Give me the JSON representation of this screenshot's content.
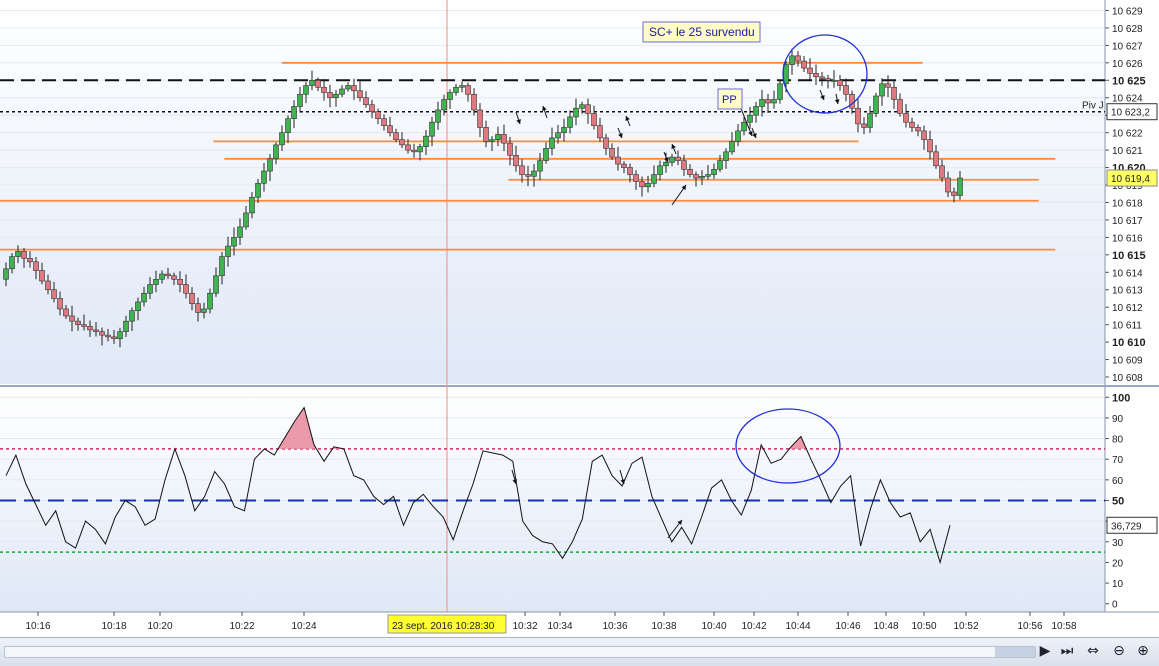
{
  "chart_data": [
    {
      "type": "candlestick",
      "title": "",
      "ylim": [
        10607.6,
        10629.6
      ],
      "y_ticks": [
        10608,
        10609,
        10610,
        10611,
        10612,
        10613,
        10614,
        10615,
        10616,
        10617,
        10618,
        10619,
        10620,
        10621,
        10622,
        10623,
        10624,
        10625,
        10626,
        10627,
        10628,
        10629
      ],
      "y_tick_labels": [
        "10 608",
        "10 609",
        "10 610",
        "10 611",
        "10 612",
        "10 613",
        "10 614",
        "10 615",
        "10 616",
        "10 617",
        "10 618",
        "10 619",
        "10 620",
        "10 621",
        "10 622",
        "10 623",
        "10 624",
        "10 625",
        "10 626",
        "10 627",
        "10 628",
        "10 629"
      ],
      "bold_ticks": [
        10610,
        10615,
        10620,
        10625
      ],
      "close_series": [
        10614.2,
        10614.9,
        10615.2,
        10614.8,
        10614.6,
        10614.1,
        10613.5,
        10613.0,
        10612.5,
        10611.9,
        10611.5,
        10611.2,
        10611.0,
        10610.9,
        10610.7,
        10610.6,
        10610.4,
        10610.3,
        10610.2,
        10610.6,
        10611.2,
        10611.8,
        10612.3,
        10612.8,
        10613.3,
        10613.6,
        10613.9,
        10613.8,
        10613.6,
        10613.3,
        10612.8,
        10612.2,
        10611.7,
        10611.9,
        10612.8,
        10613.8,
        10614.9,
        10615.5,
        10616.0,
        10616.6,
        10617.4,
        10618.3,
        10619.1,
        10619.8,
        10620.5,
        10621.3,
        10622.0,
        10622.8,
        10623.5,
        10624.2,
        10624.7,
        10625.0,
        10624.6,
        10624.3,
        10624.0,
        10624.2,
        10624.5,
        10624.7,
        10624.4,
        10624.0,
        10623.6,
        10623.2,
        10622.8,
        10622.4,
        10622.0,
        10621.6,
        10621.3,
        10621.0,
        10620.9,
        10621.2,
        10621.8,
        10622.6,
        10623.3,
        10623.9,
        10624.3,
        10624.6,
        10624.7,
        10624.2,
        10623.3,
        10622.3,
        10621.5,
        10621.6,
        10621.9,
        10621.4,
        10620.7,
        10620.1,
        10619.6,
        10619.5,
        10619.8,
        10620.4,
        10621.1,
        10621.7,
        10622.0,
        10622.3,
        10622.9,
        10623.4,
        10623.6,
        10623.1,
        10622.4,
        10621.7,
        10621.1,
        10620.6,
        10620.2,
        10620.0,
        10619.6,
        10619.2,
        10618.9,
        10619.1,
        10619.6,
        10620.1,
        10620.3,
        10620.6,
        10620.4,
        10619.9,
        10619.6,
        10619.4,
        10619.5,
        10619.6,
        10619.9,
        10620.4,
        10620.9,
        10621.5,
        10622.1,
        10622.6,
        10623.0,
        10623.5,
        10623.9,
        10623.7,
        10623.9,
        10624.8,
        10625.9,
        10626.4,
        10626.1,
        10625.7,
        10625.4,
        10625.2,
        10625.1,
        10625.0,
        10625.0,
        10624.7,
        10624.2,
        10623.4,
        10622.5,
        10622.3,
        10623.1,
        10624.1,
        10624.8,
        10624.6,
        10623.9,
        10623.1,
        10622.6,
        10622.3,
        10622.1,
        10621.6,
        10620.9,
        10620.1,
        10619.4,
        10618.6,
        10618.4,
        10619.4
      ],
      "last_price_label": "10 619,4",
      "pivot_label": "Piv J",
      "pivot_value_label": "10 623,2",
      "pivot_level": 10623.2,
      "dashed_level": 10625.0,
      "support_resistance_levels": [
        {
          "y": 10626.0,
          "from": 0.255,
          "to": 0.835
        },
        {
          "y": 10621.5,
          "from": 0.193,
          "to": 0.777
        },
        {
          "y": 10620.5,
          "from": 0.203,
          "to": 0.955
        },
        {
          "y": 10619.3,
          "from": 0.46,
          "to": 0.94
        },
        {
          "y": 10618.1,
          "from": 0.0,
          "to": 0.94
        },
        {
          "y": 10615.3,
          "from": 0.0,
          "to": 0.955
        }
      ],
      "annotations": [
        {
          "text": "SC+ le 25 survendu"
        },
        {
          "text": "PP"
        }
      ]
    },
    {
      "type": "line",
      "ylim": [
        -4,
        104
      ],
      "y_ticks": [
        0,
        10,
        20,
        30,
        40,
        50,
        60,
        70,
        80,
        90,
        100
      ],
      "y_tick_labels": [
        "0",
        "10",
        "20",
        "30",
        "40",
        "50",
        "60",
        "70",
        "80",
        "90",
        "100"
      ],
      "bold_ticks": [
        50,
        100
      ],
      "series": [
        {
          "values": [
            62,
            72,
            58,
            48,
            38,
            45,
            30,
            27,
            40,
            36,
            29,
            42,
            50,
            47,
            38,
            41,
            60,
            75,
            62,
            45,
            52,
            64,
            58,
            47,
            45,
            70,
            75,
            72,
            80,
            88,
            95,
            77,
            69,
            76,
            75,
            62,
            60,
            52,
            48,
            52,
            38,
            49,
            53,
            47,
            42,
            31,
            45,
            58,
            74,
            73,
            72,
            69,
            40,
            33,
            30,
            29,
            22,
            30,
            41,
            69,
            72,
            62,
            57,
            68,
            71,
            52,
            41,
            30,
            37,
            29,
            42,
            56,
            60,
            50,
            43,
            55,
            77,
            68,
            70,
            76,
            81,
            70,
            60,
            49,
            57,
            62,
            28,
            46,
            60,
            49,
            42,
            44,
            30,
            36,
            20,
            38
          ]
        }
      ],
      "current_value_label": "36,729",
      "levels": [
        {
          "y": 75,
          "color": "#e0245e"
        },
        {
          "y": 50,
          "color": "#1a33aa"
        },
        {
          "y": 25,
          "color": "#1aa833"
        }
      ],
      "overbought_fill_color": "#e88a9a"
    }
  ],
  "x_axis": {
    "time_labels": [
      "10:16",
      "10:18",
      "10:20",
      "10:22",
      "10:24",
      "10:32",
      "10:34",
      "10:36",
      "10:38",
      "10:40",
      "10:42",
      "10:44",
      "10:46",
      "10:48",
      "10:50",
      "10:52",
      "10:56",
      "10:58"
    ],
    "cursor_label": "23 sept. 2016 10:28:30"
  },
  "colors": {
    "bullish": "#3fb34f",
    "bearish": "#e07880",
    "level_line": "#ff8a3d",
    "annotation_circle": "#1f2fd8",
    "panel_bg_top": "#ffffff",
    "panel_bg_bottom": "#dfe8f7"
  },
  "toolbar": {
    "buttons": [
      "scroll-right-icon",
      "scroll-end-icon",
      "zoom-reset-icon",
      "zoom-out-icon",
      "zoom-in-icon"
    ],
    "glyphs": [
      "▶",
      "⏭",
      "⇔",
      "⊖",
      "⊕"
    ]
  }
}
